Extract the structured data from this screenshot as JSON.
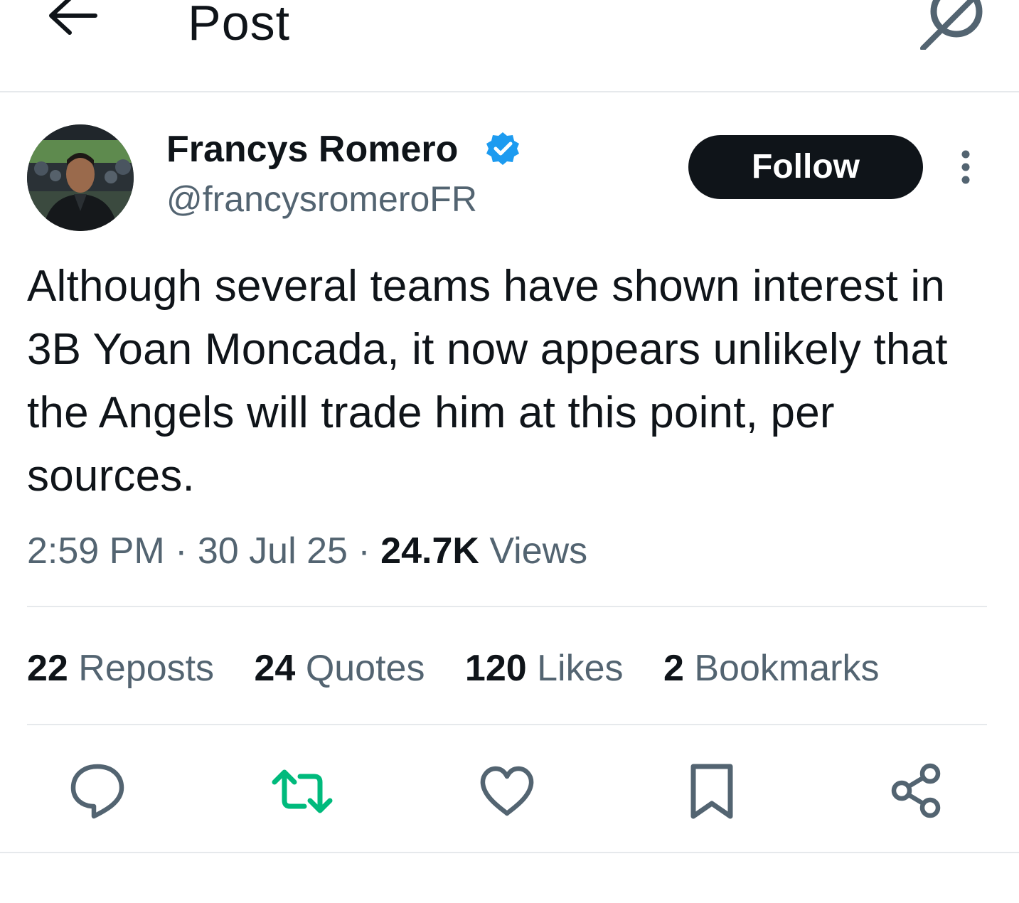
{
  "header": {
    "title": "Post",
    "back_icon": "arrow-left-icon",
    "grok_icon": "grok-icon"
  },
  "author": {
    "display_name": "Francys Romero",
    "handle": "@francysromeroFR",
    "verified": true,
    "verified_color": "#1d9bf0"
  },
  "follow_button": {
    "label": "Follow"
  },
  "more_icon": "more-vertical-icon",
  "tweet": {
    "text": "Although several teams have shown interest in 3B Yoan Moncada, it now appears unlikely that the Angels will trade him at this point, per sources.",
    "time": "2:59 PM",
    "separator": "·",
    "date": "30 Jul 25",
    "views_count": "24.7K",
    "views_label": "Views"
  },
  "stats": [
    {
      "count": "22",
      "label": "Reposts"
    },
    {
      "count": "24",
      "label": "Quotes"
    },
    {
      "count": "120",
      "label": "Likes"
    },
    {
      "count": "2",
      "label": "Bookmarks"
    }
  ],
  "actions": [
    {
      "icon": "reply-icon",
      "color": "#536471"
    },
    {
      "icon": "repost-icon",
      "color": "#00ba7c",
      "active": true
    },
    {
      "icon": "like-icon",
      "color": "#536471"
    },
    {
      "icon": "bookmark-icon",
      "color": "#536471"
    },
    {
      "icon": "share-icon",
      "color": "#536471"
    }
  ],
  "colors": {
    "text_primary": "#0f1419",
    "text_secondary": "#536471",
    "divider": "#e6e9ec",
    "follow_bg": "#0f1419",
    "repost_active": "#00ba7c"
  }
}
